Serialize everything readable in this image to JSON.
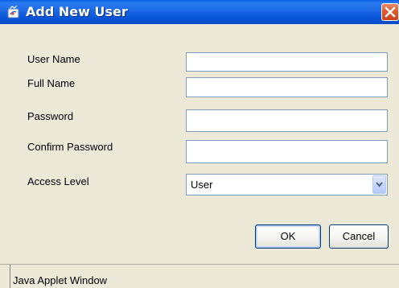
{
  "window": {
    "title": "Add New User",
    "icon": "java-cup-icon",
    "close_icon": "close-icon",
    "colors": {
      "titlebar": "#0a5ee0",
      "client": "#ece9d8",
      "close": "#e05a30",
      "field_border": "#7f9db9"
    }
  },
  "form": {
    "username": {
      "label": "User Name",
      "value": ""
    },
    "fullname": {
      "label": "Full Name",
      "value": ""
    },
    "password": {
      "label": "Password",
      "value": ""
    },
    "confirm_password": {
      "label": "Confirm Password",
      "value": ""
    },
    "access_level": {
      "label": "Access Level",
      "selected": "User",
      "icon": "chevron-down-icon"
    }
  },
  "buttons": {
    "ok": "OK",
    "cancel": "Cancel"
  },
  "status": {
    "text": "Java Applet Window"
  }
}
